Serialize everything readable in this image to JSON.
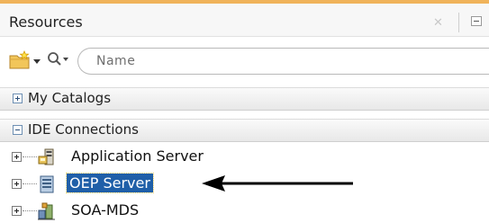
{
  "panel": {
    "title": "Resources",
    "close_icon": "close-icon",
    "minimize_icon": "minimize-icon"
  },
  "toolbar": {
    "new_icon": "new-folder-icon",
    "search_mode_icon": "search-icon",
    "search_placeholder": "Name",
    "search_value": ""
  },
  "sections": [
    {
      "label": "My Catalogs",
      "state": "collapsed"
    },
    {
      "label": "IDE Connections",
      "state": "expanded"
    }
  ],
  "tree": {
    "items": [
      {
        "label": "Application Server",
        "icon": "application-server-icon",
        "selected": false
      },
      {
        "label": "OEP Server",
        "icon": "oep-server-icon",
        "selected": true
      },
      {
        "label": "SOA-MDS",
        "icon": "soa-mds-icon",
        "selected": false
      }
    ]
  },
  "colors": {
    "accent_top": "#f0b35a",
    "selection": "#1f5fa8"
  }
}
